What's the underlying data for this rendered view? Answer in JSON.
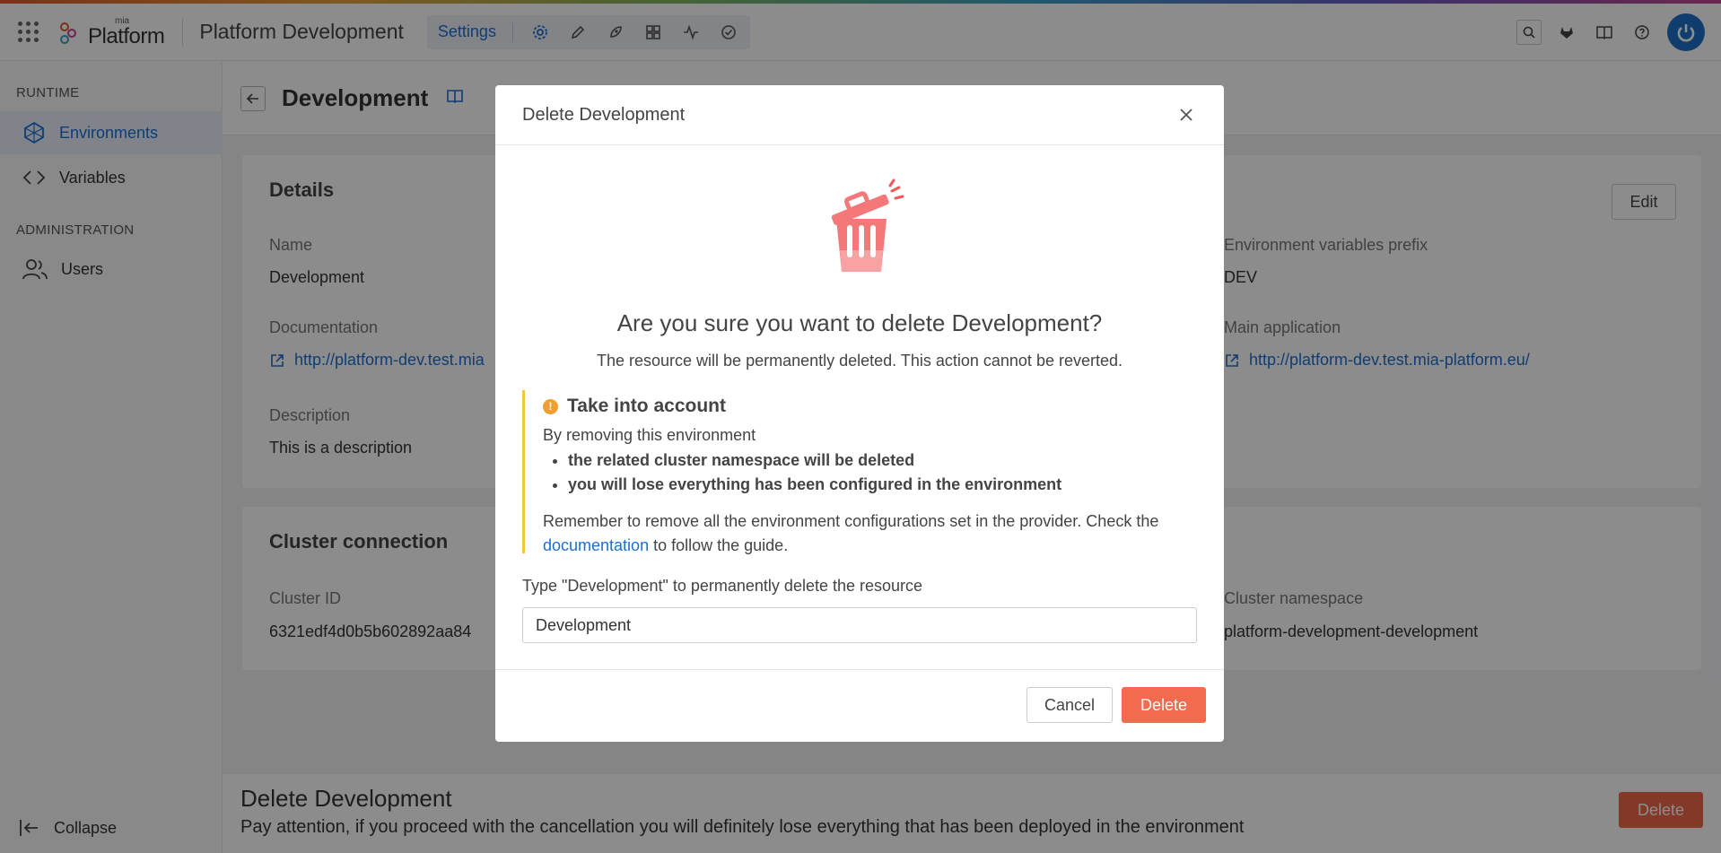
{
  "topbar": {
    "logo_small": "mia",
    "logo_text": "Platform",
    "project_title": "Platform Development",
    "settings_label": "Settings"
  },
  "sidebar": {
    "runtime_label": "RUNTIME",
    "items_runtime": [
      {
        "label": "Environments",
        "icon": "environments-icon"
      },
      {
        "label": "Variables",
        "icon": "code-icon"
      }
    ],
    "admin_label": "ADMINISTRATION",
    "items_admin": [
      {
        "label": "Users",
        "icon": "users-icon"
      }
    ],
    "collapse_label": "Collapse"
  },
  "page": {
    "title": "Development",
    "details": {
      "title": "Details",
      "edit_label": "Edit",
      "name_label": "Name",
      "name_value": "Development",
      "documentation_label": "Documentation",
      "documentation_value": "http://platform-dev.test.mia",
      "description_label": "Description",
      "description_value": "This is a description",
      "prefix_label": "Environment variables prefix",
      "prefix_value": "DEV",
      "main_app_label": "Main application",
      "main_app_value": "http://platform-dev.test.mia-platform.eu/"
    },
    "cluster": {
      "title": "Cluster connection",
      "cluster_id_label": "Cluster ID",
      "cluster_id_value": "6321edf4d0b5b602892aa84",
      "namespace_label": "Cluster namespace",
      "namespace_value": "platform-development-development"
    },
    "danger": {
      "title": "Delete Development",
      "text": "Pay attention, if you proceed with the cancellation you will definitely lose everything that has been deployed in the environment",
      "delete_label": "Delete"
    }
  },
  "modal": {
    "title": "Delete Development",
    "question": "Are you sure you want to delete Development?",
    "subtitle": "The resource will be permanently deleted. This action cannot be reverted.",
    "callout": {
      "title": "Take into account",
      "intro": "By removing this environment",
      "bullets": [
        "the related cluster namespace will be deleted",
        "you will lose everything has been configured in the environment"
      ],
      "note_before": "Remember to remove all the environment configurations set in the provider. Check the ",
      "note_link": "documentation",
      "note_after": " to follow the guide."
    },
    "type_label": "Type \"Development\" to permanently delete the resource",
    "input_value": "Development",
    "cancel_label": "Cancel",
    "delete_label": "Delete"
  },
  "colors": {
    "accent": "#1c6fd1",
    "danger": "#f26b4e",
    "warning": "#f0a030"
  }
}
